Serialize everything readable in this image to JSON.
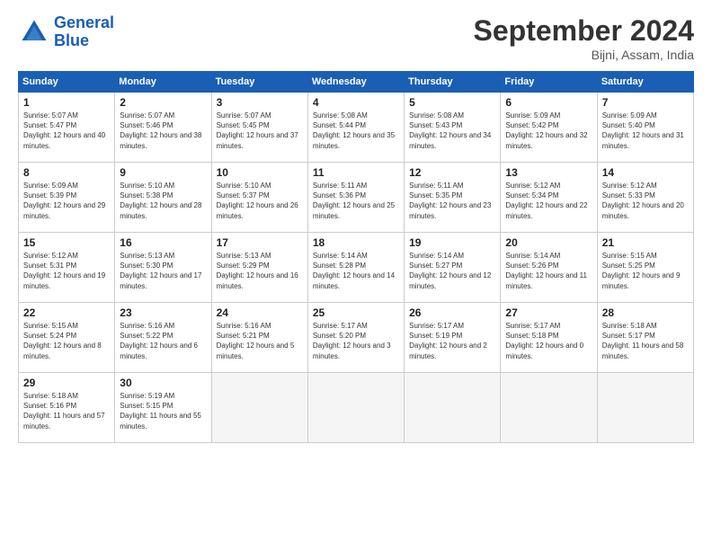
{
  "header": {
    "logo_line1": "General",
    "logo_line2": "Blue",
    "month_title": "September 2024",
    "location": "Bijni, Assam, India"
  },
  "calendar": {
    "days_of_week": [
      "Sunday",
      "Monday",
      "Tuesday",
      "Wednesday",
      "Thursday",
      "Friday",
      "Saturday"
    ],
    "weeks": [
      [
        {
          "day": "1",
          "sunrise": "5:07 AM",
          "sunset": "5:47 PM",
          "daylight": "12 hours and 40 minutes."
        },
        {
          "day": "2",
          "sunrise": "5:07 AM",
          "sunset": "5:46 PM",
          "daylight": "12 hours and 38 minutes."
        },
        {
          "day": "3",
          "sunrise": "5:07 AM",
          "sunset": "5:45 PM",
          "daylight": "12 hours and 37 minutes."
        },
        {
          "day": "4",
          "sunrise": "5:08 AM",
          "sunset": "5:44 PM",
          "daylight": "12 hours and 35 minutes."
        },
        {
          "day": "5",
          "sunrise": "5:08 AM",
          "sunset": "5:43 PM",
          "daylight": "12 hours and 34 minutes."
        },
        {
          "day": "6",
          "sunrise": "5:09 AM",
          "sunset": "5:42 PM",
          "daylight": "12 hours and 32 minutes."
        },
        {
          "day": "7",
          "sunrise": "5:09 AM",
          "sunset": "5:40 PM",
          "daylight": "12 hours and 31 minutes."
        }
      ],
      [
        {
          "day": "8",
          "sunrise": "5:09 AM",
          "sunset": "5:39 PM",
          "daylight": "12 hours and 29 minutes."
        },
        {
          "day": "9",
          "sunrise": "5:10 AM",
          "sunset": "5:38 PM",
          "daylight": "12 hours and 28 minutes."
        },
        {
          "day": "10",
          "sunrise": "5:10 AM",
          "sunset": "5:37 PM",
          "daylight": "12 hours and 26 minutes."
        },
        {
          "day": "11",
          "sunrise": "5:11 AM",
          "sunset": "5:36 PM",
          "daylight": "12 hours and 25 minutes."
        },
        {
          "day": "12",
          "sunrise": "5:11 AM",
          "sunset": "5:35 PM",
          "daylight": "12 hours and 23 minutes."
        },
        {
          "day": "13",
          "sunrise": "5:12 AM",
          "sunset": "5:34 PM",
          "daylight": "12 hours and 22 minutes."
        },
        {
          "day": "14",
          "sunrise": "5:12 AM",
          "sunset": "5:33 PM",
          "daylight": "12 hours and 20 minutes."
        }
      ],
      [
        {
          "day": "15",
          "sunrise": "5:12 AM",
          "sunset": "5:31 PM",
          "daylight": "12 hours and 19 minutes."
        },
        {
          "day": "16",
          "sunrise": "5:13 AM",
          "sunset": "5:30 PM",
          "daylight": "12 hours and 17 minutes."
        },
        {
          "day": "17",
          "sunrise": "5:13 AM",
          "sunset": "5:29 PM",
          "daylight": "12 hours and 16 minutes."
        },
        {
          "day": "18",
          "sunrise": "5:14 AM",
          "sunset": "5:28 PM",
          "daylight": "12 hours and 14 minutes."
        },
        {
          "day": "19",
          "sunrise": "5:14 AM",
          "sunset": "5:27 PM",
          "daylight": "12 hours and 12 minutes."
        },
        {
          "day": "20",
          "sunrise": "5:14 AM",
          "sunset": "5:26 PM",
          "daylight": "12 hours and 11 minutes."
        },
        {
          "day": "21",
          "sunrise": "5:15 AM",
          "sunset": "5:25 PM",
          "daylight": "12 hours and 9 minutes."
        }
      ],
      [
        {
          "day": "22",
          "sunrise": "5:15 AM",
          "sunset": "5:24 PM",
          "daylight": "12 hours and 8 minutes."
        },
        {
          "day": "23",
          "sunrise": "5:16 AM",
          "sunset": "5:22 PM",
          "daylight": "12 hours and 6 minutes."
        },
        {
          "day": "24",
          "sunrise": "5:16 AM",
          "sunset": "5:21 PM",
          "daylight": "12 hours and 5 minutes."
        },
        {
          "day": "25",
          "sunrise": "5:17 AM",
          "sunset": "5:20 PM",
          "daylight": "12 hours and 3 minutes."
        },
        {
          "day": "26",
          "sunrise": "5:17 AM",
          "sunset": "5:19 PM",
          "daylight": "12 hours and 2 minutes."
        },
        {
          "day": "27",
          "sunrise": "5:17 AM",
          "sunset": "5:18 PM",
          "daylight": "12 hours and 0 minutes."
        },
        {
          "day": "28",
          "sunrise": "5:18 AM",
          "sunset": "5:17 PM",
          "daylight": "11 hours and 58 minutes."
        }
      ],
      [
        {
          "day": "29",
          "sunrise": "5:18 AM",
          "sunset": "5:16 PM",
          "daylight": "11 hours and 57 minutes."
        },
        {
          "day": "30",
          "sunrise": "5:19 AM",
          "sunset": "5:15 PM",
          "daylight": "11 hours and 55 minutes."
        },
        null,
        null,
        null,
        null,
        null
      ]
    ]
  }
}
